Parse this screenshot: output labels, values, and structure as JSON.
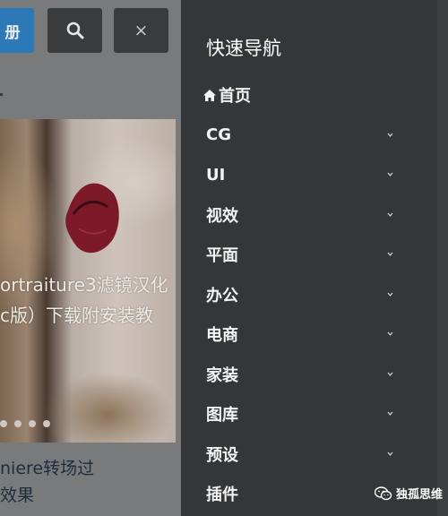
{
  "header": {
    "register_label": "册",
    "search_icon": "search-icon",
    "close_label": "×"
  },
  "banner": {
    "title_line1": "ortraiture3滤镜汉化",
    "title_line2": "c版）下载附安装教",
    "dots": 4
  },
  "article": {
    "title_line1": "niere转场过",
    "title_line2": "效果"
  },
  "drawer": {
    "title": "快速导航",
    "items": [
      {
        "label": "首页",
        "icon": "home-icon",
        "expandable": false
      },
      {
        "label": "CG",
        "expandable": true
      },
      {
        "label": "UI",
        "expandable": true
      },
      {
        "label": "视效",
        "expandable": true
      },
      {
        "label": "平面",
        "expandable": true
      },
      {
        "label": "办公",
        "expandable": true
      },
      {
        "label": "电商",
        "expandable": true
      },
      {
        "label": "家装",
        "expandable": true
      },
      {
        "label": "图库",
        "expandable": true
      },
      {
        "label": "预设",
        "expandable": true
      },
      {
        "label": "插件",
        "expandable": false
      }
    ]
  },
  "watermark": {
    "text": "独孤思维",
    "icon": "wechat-icon"
  },
  "colors": {
    "drawer_bg": "#343637",
    "register_button": "#2d79b8",
    "dark_button": "#3a3b3c"
  }
}
